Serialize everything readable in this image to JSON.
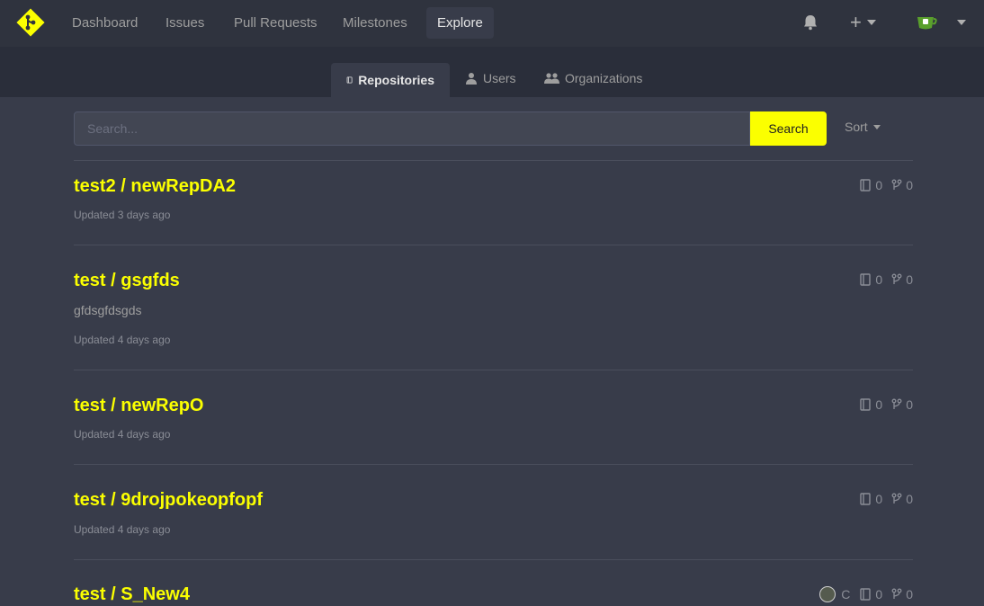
{
  "nav": {
    "items": [
      "Dashboard",
      "Issues",
      "Pull Requests",
      "Milestones",
      "Explore"
    ],
    "active": "Explore"
  },
  "colors": {
    "accent": "#fbff00",
    "nav_bg": "#2f333e",
    "page_bg": "#383c4a"
  },
  "tabs": [
    {
      "label": "Repositories",
      "icon": "repo-icon",
      "active": true
    },
    {
      "label": "Users",
      "icon": "user-icon",
      "active": false
    },
    {
      "label": "Organizations",
      "icon": "organization-icon",
      "active": false
    }
  ],
  "search": {
    "placeholder": "Search...",
    "value": "",
    "button": "Search"
  },
  "sort": {
    "label": "Sort"
  },
  "repos": [
    {
      "owner": "test2",
      "name": "newRepDA2",
      "title": "test2 / newRepDA2",
      "description": "",
      "updated": "Updated 3 days ago",
      "language": "",
      "stars": "0",
      "forks": "0"
    },
    {
      "owner": "test",
      "name": "gsgfds",
      "title": "test / gsgfds",
      "description": "gfdsgfdsgds",
      "updated": "Updated 4 days ago",
      "language": "",
      "stars": "0",
      "forks": "0"
    },
    {
      "owner": "test",
      "name": "newRepO",
      "title": "test / newRepO",
      "description": "",
      "updated": "Updated 4 days ago",
      "language": "",
      "stars": "0",
      "forks": "0"
    },
    {
      "owner": "test",
      "name": "9drojpokeopfopf",
      "title": "test / 9drojpokeopfopf",
      "description": "",
      "updated": "Updated 4 days ago",
      "language": "",
      "stars": "0",
      "forks": "0"
    },
    {
      "owner": "test",
      "name": "S_New4",
      "title": "test / S_New4",
      "description": "",
      "updated": "",
      "language": "C",
      "stars": "0",
      "forks": "0"
    }
  ]
}
